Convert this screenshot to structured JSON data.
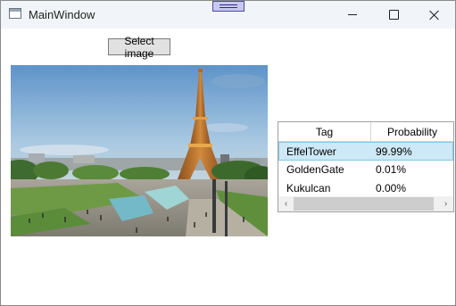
{
  "window": {
    "title": "MainWindow",
    "icon": "app-window-icon",
    "caption_buttons": [
      "minimize-icon",
      "maximize-icon",
      "close-icon"
    ]
  },
  "toolbar": {
    "select_image_label": "Select image"
  },
  "image": {
    "description_icon": "photo"
  },
  "results": {
    "columns": [
      "Tag",
      "Probability"
    ],
    "rows": [
      {
        "tag": "EffelTower",
        "probability": "99.99%",
        "selected": true
      },
      {
        "tag": "GoldenGate",
        "probability": "0.01%",
        "selected": false
      },
      {
        "tag": "Kukulcan",
        "probability": "0.00%",
        "selected": false
      }
    ],
    "scroll_left_glyph": "‹",
    "scroll_right_glyph": "›"
  },
  "colors": {
    "titlebar": "#f1f5f9",
    "selection_fill": "#cde8f6",
    "selection_border": "#7fc7ec",
    "button_face": "#e1e1e1"
  }
}
